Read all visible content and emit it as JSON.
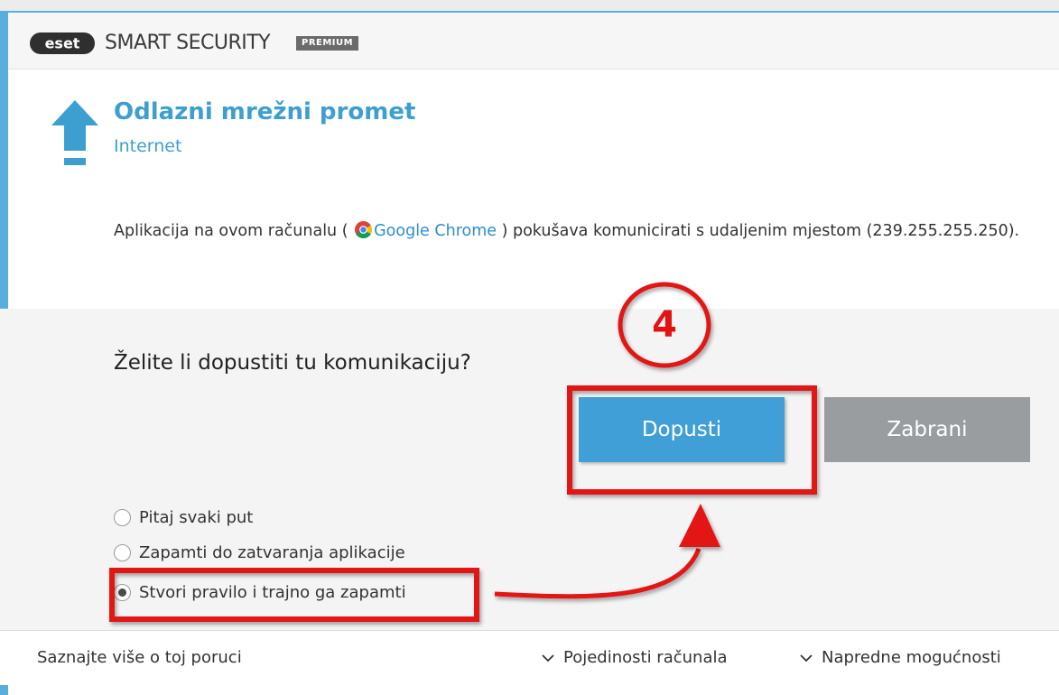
{
  "titlebar": {
    "logo": "eset",
    "product_name": "SMART SECURITY",
    "edition": "PREMIUM"
  },
  "alert": {
    "icon": "upload-arrow-icon",
    "title": "Odlazni mrežni promet",
    "subtitle": "Internet",
    "message_before": "Aplikacija na ovom računalu ( ",
    "app_icon": "chrome-icon",
    "app_name": "Google Chrome",
    "message_after": " ) pokušava komunicirati s udaljenim mjestom (239.255.255.250)."
  },
  "decision": {
    "question": "Želite li dopustiti tu komunikaciju?",
    "allow_label": "Dopusti",
    "deny_label": "Zabrani",
    "options": [
      {
        "label": "Pitaj svaki put",
        "checked": false
      },
      {
        "label": "Zapamti do zatvaranja aplikacije",
        "checked": false
      },
      {
        "label": "Stvori pravilo i trajno ga zapamti",
        "checked": true
      }
    ]
  },
  "footer": {
    "learn_more": "Saznajte više o toj poruci",
    "computer_details": "Pojedinosti računala",
    "advanced_options": "Napredne mogućnosti"
  },
  "annotation": {
    "step": "4"
  },
  "colors": {
    "accent": "#3f9fd6",
    "deny": "#9a9da0",
    "annotation": "#e31212"
  }
}
